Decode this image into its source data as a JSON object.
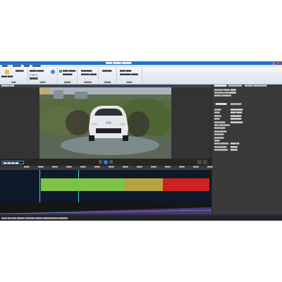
{
  "window": {
    "title": "▆▆▆▆ ▆▆▆▆▆ ▆▆▆▆▆▆"
  },
  "tabs": [
    "▆▆▆▆",
    "▆▆▆▆▆▆",
    "▆▆▆▆",
    "▆▆▆▆▆▆"
  ],
  "ribbon": {
    "group1": {
      "btn1": "▆▆▆▆ ▆▆▆▆",
      "btn2": "▆▆▆▆▆▆",
      "caption": "▆▆▆▆"
    },
    "group2": {
      "btn1": "▆▆▆▆▆ ▆▆▆▆▆",
      "btn2": "▆▆▆▆▆▆",
      "zoom_value": "100",
      "caption": "▆▆▆▆▆"
    },
    "group3": {
      "btn1": "▆▆▆▆ ▆▆▆▆▆",
      "btn2": "▆▆▆▆▆▆▆",
      "caption": "▆▆▆▆▆▆"
    },
    "group4": {
      "btn1": "▆▆▆▆▆▆▆▆",
      "btn2": "▆▆▆▆▆▆ ▆▆▆▆▆",
      "caption": "▆▆▆▆▆▆▆"
    },
    "group5": {
      "btn1": "▆▆▆▆▆▆▆",
      "caption": "▆▆▆▆▆▆"
    },
    "group6": {
      "btn1": "▆▆▆▆ ▆▆▆▆",
      "btn2": "▆▆▆▆▆▆▆▆ ▆▆▆▆▆",
      "caption": "▆▆▆▆▆"
    }
  },
  "video_panel": {
    "title": "▆▆▆▆▆▆ ▆▆▆"
  },
  "right_panel": {
    "tabs": [
      "▆▆▆▆▆▆▆▆▆",
      "▆▆▆▆▆▆▆▆▆▆",
      "▆▆▆▆▆▆ ▆▆▆▆▆▆▆▆▆▆"
    ],
    "top_fields": [
      {
        "label": "▆▆▆▆▆▆ ▆▆▆▆▆",
        "value": "▆▆▆▆"
      },
      {
        "label": "▆▆▆▆▆▆▆ ▆▆▆▆▆",
        "value": "▆▆▆▆"
      },
      {
        "label": "▆▆▆▆▆ ▆▆▆▆▆▆▆",
        "value": ""
      }
    ],
    "section_tabs": [
      "▆▆▆▆▆▆▆▆",
      "▆▆▆▆▆▆▆▆"
    ],
    "fields": [
      {
        "label": "▆▆▆▆▆",
        "value": "▆▆▆▆▆▆▆▆▆"
      },
      {
        "label": "▆▆▆▆",
        "value": "▆▆▆▆ ▆▆▆▆"
      },
      {
        "label": "▆▆▆▆▆",
        "value": "▆▆▆▆▆▆▆▆"
      },
      {
        "label": "▆▆▆▆",
        "value": "▆▆▆▆▆▆▆▆"
      },
      {
        "label": "▆▆▆▆▆▆▆▆",
        "value": "▆▆▆▆▆▆▆▆▆"
      },
      {
        "label": "▆▆▆ ▆▆▆▆▆▆▆▆",
        "value": ""
      },
      {
        "label": "▆▆▆▆▆▆▆▆",
        "value": ""
      },
      {
        "label": "▆▆▆▆▆▆▆▆▆",
        "value": ""
      },
      {
        "label": "▆▆▆▆▆▆▆",
        "value": ""
      },
      {
        "label": "▆▆▆▆▆▆▆",
        "value": ""
      },
      {
        "label": "▆▆▆▆",
        "value": ""
      },
      {
        "label": "▆▆▆▆ ▆▆▆▆▆▆",
        "value": "▆▆▆▆ ▆▆"
      },
      {
        "label": "▆▆▆▆▆▆▆▆▆",
        "value": "▆▆▆▆▆"
      },
      {
        "label": "▆▆▆▆▆▆▆▆▆▆",
        "value": "▆▆▆▆▆"
      }
    ]
  },
  "timeline": {
    "timecode": "▆▆:▆▆:▆▆:▆▆",
    "ticks": [
      "▆▆▆▆▆",
      "▆▆▆▆▆",
      "▆▆▆▆▆",
      "▆▆▆▆▆",
      "▆▆▆▆▆",
      "▆▆▆▆▆",
      "▆▆▆▆▆",
      "▆▆▆▆▆",
      "▆▆▆▆▆",
      "▆▆▆▆▆",
      "▆▆▆▆▆",
      "▆▆▆▆▆",
      "▆▆▆▆▆",
      "▆▆▆▆▆"
    ],
    "segments": [
      {
        "color": "#7fc24a"
      },
      {
        "color": "#7fc24a"
      },
      {
        "color": "#b5a33d"
      },
      {
        "color": "#cc2222"
      }
    ]
  },
  "status": {
    "text": "▆▆▆▆ ▆▆▆ ▆▆▆ ▆▆▆▆▆▆ ▆▆▆▆▆▆▆ ▆▆▆▆▆ ▆▆▆▆▆▆▆▆▆▆▆ ▆▆▆▆▆▆▆"
  },
  "colors": {
    "accent": "#1f6fd1",
    "playhead": "#3dd6c8"
  }
}
